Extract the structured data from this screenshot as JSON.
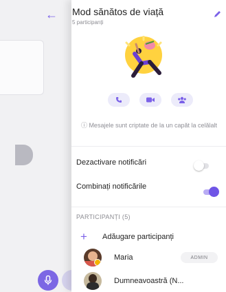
{
  "header": {
    "title": "Mod sănătos de viață",
    "subtitle": "5 participanți"
  },
  "encryption_notice": "ⓘ Mesajele sunt criptate de la un capăt la celălalt",
  "settings": [
    {
      "label": "Dezactivare notificări",
      "enabled": false
    },
    {
      "label": "Combinați notificările",
      "enabled": true
    }
  ],
  "participants": {
    "section_title": "PARTICIPANȚI (5)",
    "add_label": "Adăugare participanți",
    "members": [
      {
        "name": "Maria",
        "badge": "ADMIN"
      },
      {
        "name": "Dumneavoastră (N..."
      }
    ]
  },
  "colors": {
    "accent": "#7b61e8",
    "toggle_off": "#e2e2e6",
    "bg_dim": "#f1f1f3"
  },
  "icons": [
    "back-arrow-icon",
    "edit-icon",
    "phone-icon",
    "video-icon",
    "group-icon",
    "plus-icon",
    "mic-icon"
  ]
}
